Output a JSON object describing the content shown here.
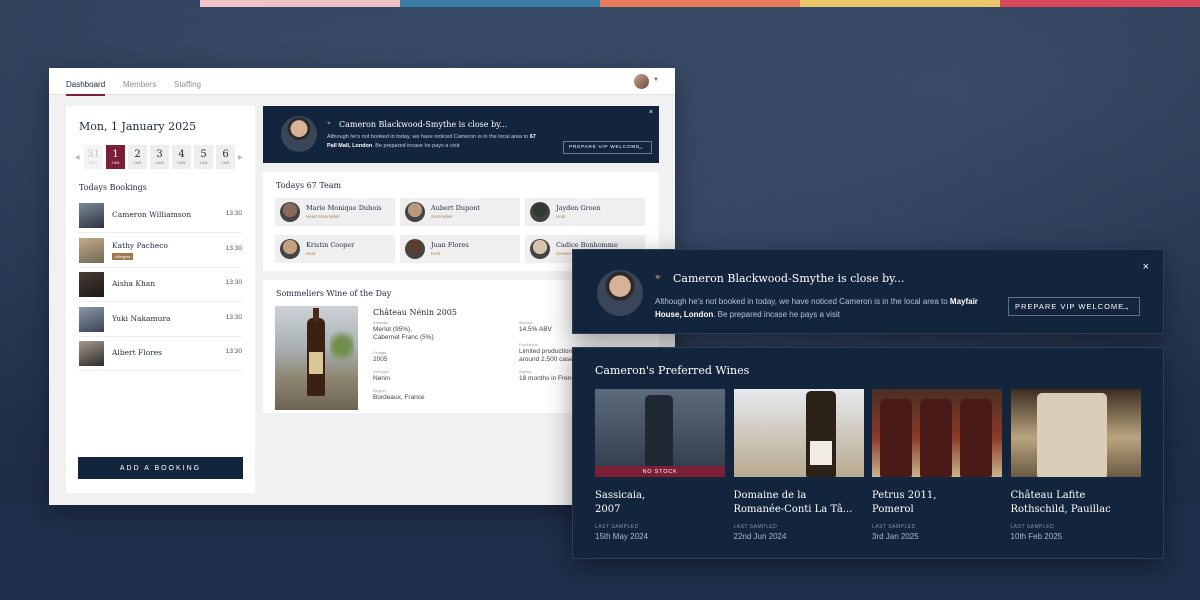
{
  "colors": {
    "navy": "#13243d",
    "burgundy": "#7b1f36",
    "gold": "#a8844f",
    "stripe": [
      "#efc2c7",
      "#3a7ea3",
      "#e8795b",
      "#e9c66a",
      "#d9475a"
    ]
  },
  "nav": {
    "tabs": [
      "Dashboard",
      "Members",
      "Staffing"
    ],
    "active_tab": "Dashboard",
    "avatar_icon": "user-avatar",
    "caret_icon": "chevron-down-icon"
  },
  "calendar": {
    "date_title": "Mon, 1 January 2025",
    "prev_icon": "chevron-left-icon",
    "next_icon": "chevron-right-icon",
    "days": [
      {
        "num": "31",
        "mon": "DEC",
        "state": "past"
      },
      {
        "num": "1",
        "mon": "JAN",
        "state": "active"
      },
      {
        "num": "2",
        "mon": "JAN",
        "state": "normal"
      },
      {
        "num": "3",
        "mon": "JAN",
        "state": "normal"
      },
      {
        "num": "4",
        "mon": "JAN",
        "state": "normal"
      },
      {
        "num": "5",
        "mon": "JAN",
        "state": "normal"
      },
      {
        "num": "6",
        "mon": "JAN",
        "state": "normal"
      }
    ]
  },
  "bookings": {
    "title": "Todays Bookings",
    "items": [
      {
        "name": "Cameron Williamson",
        "time": "13:30",
        "tag": ""
      },
      {
        "name": "Kathy Pacheco",
        "time": "13:30",
        "tag": "Allergies"
      },
      {
        "name": "Aisha Khan",
        "time": "13:30",
        "tag": ""
      },
      {
        "name": "Yuki Nakamura",
        "time": "13:30",
        "tag": ""
      },
      {
        "name": "Albert Flores",
        "time": "13:30",
        "tag": ""
      }
    ],
    "add_label": "ADD A BOOKING"
  },
  "vip_small": {
    "title": "Cameron Blackwood-Smythe is close by...",
    "desc_pre": "Although he's not booked in today, we have noticed Cameron is in the local area to ",
    "desc_place": "67 Pall Mall, London",
    "desc_post": ". Be prepared incase he pays a visit",
    "button": "PREPARE VIP WELCOME",
    "close": "×"
  },
  "team": {
    "title": "Todays 67 Team",
    "members": [
      {
        "name": "Marie Monique Dubois",
        "role": "Head Sommelier"
      },
      {
        "name": "Aubert Dupont",
        "role": "Sommelier"
      },
      {
        "name": "Jayden Green",
        "role": "Host"
      },
      {
        "name": "Kristin Cooper",
        "role": "Host"
      },
      {
        "name": "Juan Flores",
        "role": "Host"
      },
      {
        "name": "Cadice Bonhomme",
        "role": "Greeter"
      }
    ]
  },
  "wine_of_day": {
    "title": "Sommeliers Wine of the Day",
    "name": "Château Nénin 2005",
    "fields": [
      {
        "label": "Varietals",
        "value": "Merlot (95%),\nCabernet Franc (5%)"
      },
      {
        "label": "Vintage",
        "value": "2005"
      },
      {
        "label": "Vineyard",
        "value": "Nenin"
      },
      {
        "label": "Region",
        "value": "Bordeaux, France"
      },
      {
        "label": "Alcohol",
        "value": "14.5% ABV"
      },
      {
        "label": "Production",
        "value": "Limited production\naround 2,500 cases"
      },
      {
        "label": "Ageing",
        "value": "18 months in French oak"
      }
    ]
  },
  "vip_big": {
    "title": "Cameron Blackwood-Smythe is close by...",
    "desc_pre": "Although he's not booked in today, we have noticed Cameron is in the local area to ",
    "desc_place": "Mayfair House, London",
    "desc_post": ". Be prepared incase he pays a visit",
    "button": "PREPARE VIP WELCOME",
    "close": "×"
  },
  "preferred": {
    "title": "Cameron's Preferred Wines",
    "last_sampled_label": "LAST SAMPLED",
    "wines": [
      {
        "name": "Sassicaia,\n2007",
        "date": "15th May 2024",
        "badge": "NO STOCK"
      },
      {
        "name": "Domaine de la\nRomanée-Conti La Tâ...",
        "date": "22nd Jun 2024",
        "badge": ""
      },
      {
        "name": "Petrus 2011,\nPomerol",
        "date": "3rd Jan 2025",
        "badge": ""
      },
      {
        "name": "Château Lafite\nRothschild, Pauillac",
        "date": "10th Feb 2025",
        "badge": ""
      }
    ]
  }
}
